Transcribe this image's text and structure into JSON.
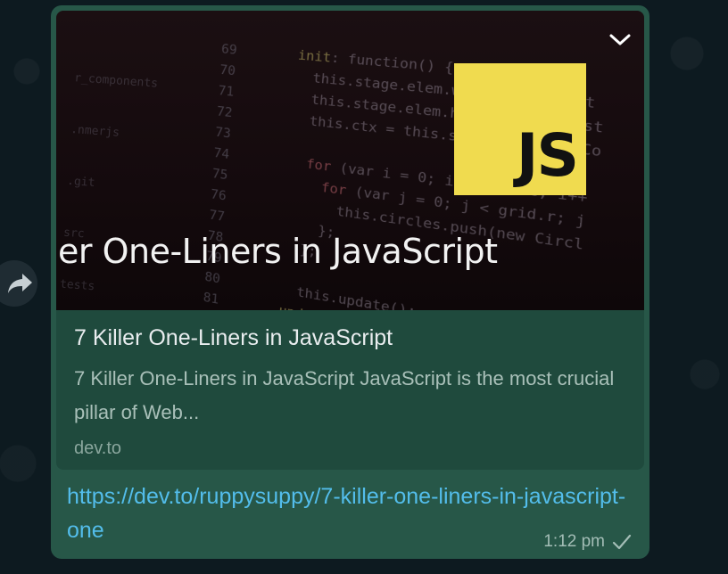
{
  "message": {
    "preview": {
      "image_caption": "er One-Liners in JavaScript",
      "logo_text": "JS",
      "title": "7 Killer One-Liners in JavaScript",
      "description": "7 Killer One-Liners in JavaScript JavaScript is the most crucial pillar of Web...",
      "domain": "dev.to"
    },
    "link": "https://dev.to/ruppysuppy/7-killer-one-liners-in-javascript-one",
    "time": "1:12 pm",
    "status_icon": "check-icon",
    "menu_icon": "chevron-down-icon"
  },
  "forward_icon": "forward-arrow-icon",
  "colors": {
    "bubble": "#275748",
    "card": "#1f4a3d",
    "link": "#53bdeb",
    "js_logo": "#f0db4f"
  }
}
